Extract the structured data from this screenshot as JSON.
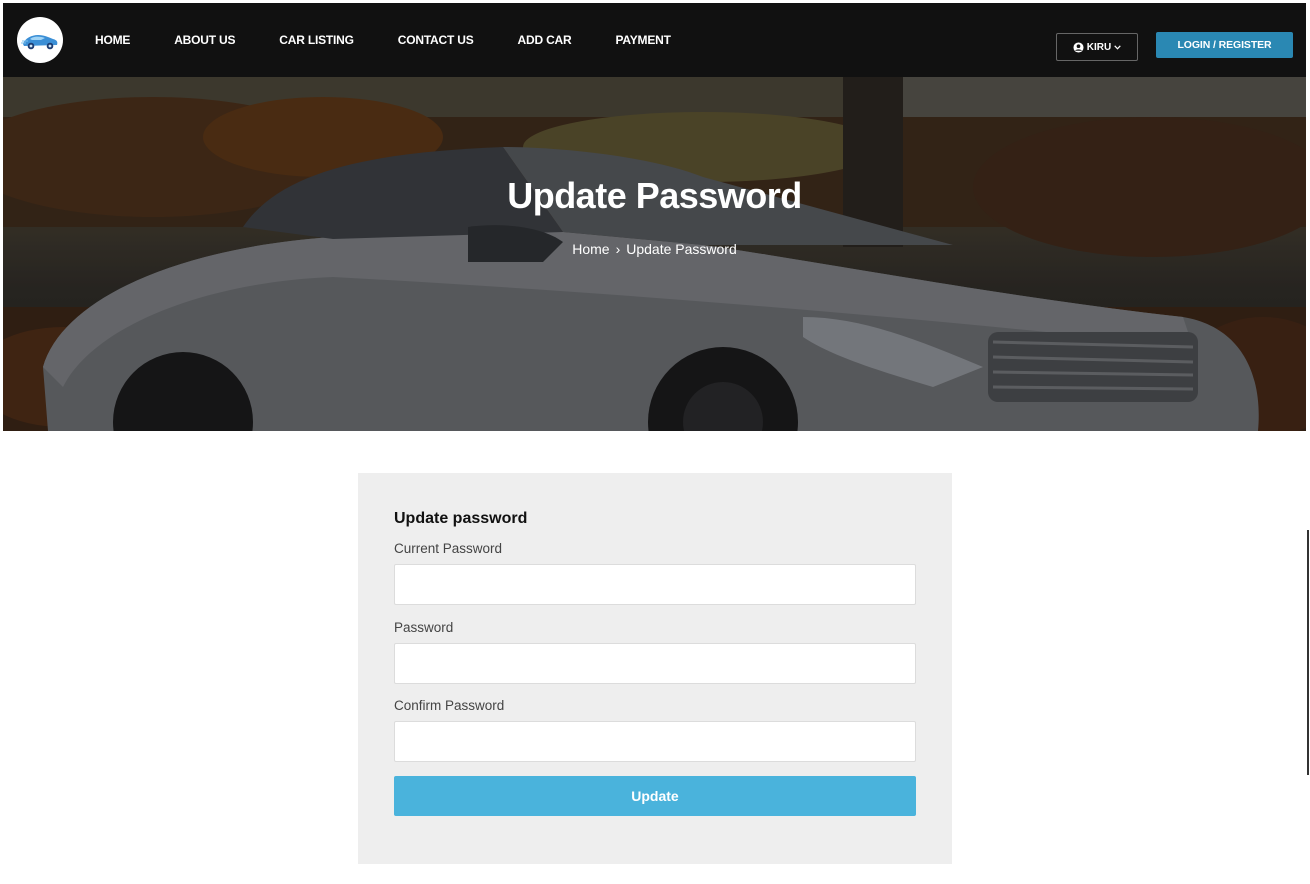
{
  "navbar": {
    "logo_icon": "car-logo-icon",
    "links": [
      "HOME",
      "ABOUT US",
      "CAR LISTING",
      "CONTACT US",
      "ADD CAR",
      "PAYMENT"
    ],
    "user_label": "KIRU",
    "login_label": "LOGIN / REGISTER",
    "login_color": "#2a88b3"
  },
  "hero": {
    "title": "Update Password",
    "breadcrumb": {
      "home": "Home",
      "separator": "›",
      "current": "Update Password"
    }
  },
  "form": {
    "title": "Update password",
    "current_password_label": "Current Password",
    "current_password_value": "",
    "password_label": "Password",
    "password_value": "",
    "confirm_password_label": "Confirm Password",
    "confirm_password_value": "",
    "submit_label": "Update",
    "submit_color": "#4ab3dc"
  }
}
